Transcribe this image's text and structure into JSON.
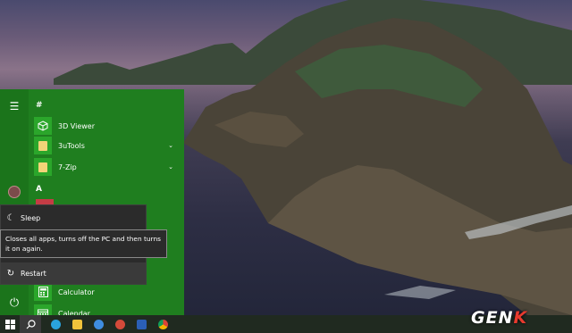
{
  "start_menu": {
    "section_hash": "#",
    "section_a": "A",
    "apps": [
      {
        "label": "3D Viewer",
        "icon": "cube-icon"
      },
      {
        "label": "3uTools",
        "icon": "folder-icon"
      },
      {
        "label": "7-Zip",
        "icon": "folder-icon"
      },
      {
        "label": "Calculator",
        "icon": "calculator-icon"
      },
      {
        "label": "Calendar",
        "icon": "calendar-icon"
      }
    ],
    "rail_icons": [
      "hamburger-icon",
      "avatar",
      "power-icon"
    ]
  },
  "power_menu": {
    "sleep_label": "Sleep",
    "restart_label": "Restart",
    "tooltip": "Closes all apps, turns off the PC and then turns it on again."
  },
  "taskbar": {
    "icons": [
      "windows-start-icon",
      "search-icon",
      "telegram-icon",
      "explorer-icon",
      "edge-icon",
      "chrome-icon",
      "word-icon"
    ]
  },
  "watermark": {
    "main": "GEN",
    "accent": "K"
  },
  "colors": {
    "accent": "#1f7e1f",
    "tile": "#2ba62b",
    "flyout": "#2b2b2b",
    "watermark_accent": "#e83a2e"
  }
}
